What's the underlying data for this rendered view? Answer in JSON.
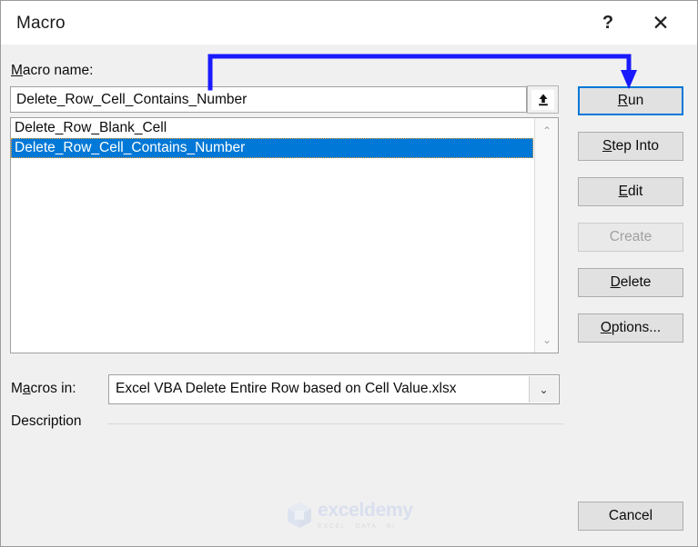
{
  "window": {
    "title": "Macro",
    "help_label": "?",
    "close_label": "✕"
  },
  "macro_name": {
    "label_prefix": "M",
    "label_rest": "acro name:",
    "value": "Delete_Row_Cell_Contains_Number",
    "placeholder": "",
    "upload_icon": "upload-arrow-icon"
  },
  "macro_list": {
    "items": [
      {
        "label": "Delete_Row_Blank_Cell",
        "selected": false
      },
      {
        "label": "Delete_Row_Cell_Contains_Number",
        "selected": true
      }
    ],
    "scroll_up_icon": "⌃",
    "scroll_down_icon": "⌄"
  },
  "buttons": {
    "run": {
      "acc": "R",
      "rest": "un",
      "state": "focused"
    },
    "step_into": {
      "acc": "S",
      "rest": "tep Into",
      "state": "normal"
    },
    "edit": {
      "acc": "E",
      "rest": "dit",
      "state": "normal"
    },
    "create": {
      "acc": "",
      "rest": "Create",
      "state": "disabled"
    },
    "delete": {
      "acc": "D",
      "rest": "elete",
      "state": "normal"
    },
    "options": {
      "acc": "O",
      "rest": "ptions...",
      "state": "normal"
    },
    "cancel": {
      "acc": "",
      "rest": "Cancel",
      "state": "normal"
    }
  },
  "macros_in": {
    "label_pre": "M",
    "label_acc": "a",
    "label_post": "cros in:",
    "value": "Excel VBA Delete Entire Row based on Cell Value.xlsx",
    "arrow_icon": "⌄"
  },
  "description": {
    "label": "Description",
    "text": ""
  },
  "watermark": {
    "name": "exceldemy",
    "tagline": "EXCEL · DATA · BI"
  },
  "annotation": {
    "color": "#1a1aff",
    "from": "macro-name-input",
    "to": "run-button"
  },
  "colors": {
    "selection": "#0078d7",
    "focus_border": "#0078d7",
    "dialog_bg": "#f0f0f0",
    "annotation": "#1a1aff"
  }
}
